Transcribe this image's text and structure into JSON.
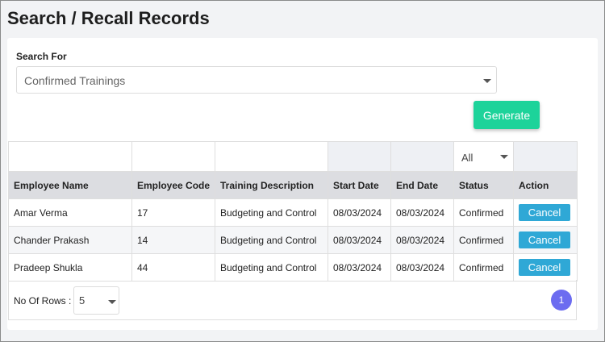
{
  "page": {
    "title": "Search / Recall Records"
  },
  "search": {
    "label": "Search For",
    "selected": "Confirmed Trainings"
  },
  "actions": {
    "generate_label": "Generate"
  },
  "table": {
    "status_filter": "All",
    "columns": [
      "Employee Name",
      "Employee Code",
      "Training Description",
      "Start Date",
      "End Date",
      "Status",
      "Action"
    ],
    "rows": [
      {
        "name": "Amar Verma",
        "code": "17",
        "description": "Budgeting and Control",
        "start": "08/03/2024",
        "end": "08/03/2024",
        "status": "Confirmed",
        "action": "Cancel"
      },
      {
        "name": "Chander Prakash",
        "code": "14",
        "description": "Budgeting and Control",
        "start": "08/03/2024",
        "end": "08/03/2024",
        "status": "Confirmed",
        "action": "Cancel"
      },
      {
        "name": "Pradeep Shukla",
        "code": "44",
        "description": "Budgeting and Control",
        "start": "08/03/2024",
        "end": "08/03/2024",
        "status": "Confirmed",
        "action": "Cancel"
      }
    ]
  },
  "footer": {
    "rows_label": "No Of Rows :",
    "rows_value": "5",
    "current_page": "1"
  },
  "colors": {
    "generate": "#1dd39a",
    "cancel": "#2fa8d6",
    "pager": "#6c6cf0",
    "header_bg": "#dcdde1"
  }
}
